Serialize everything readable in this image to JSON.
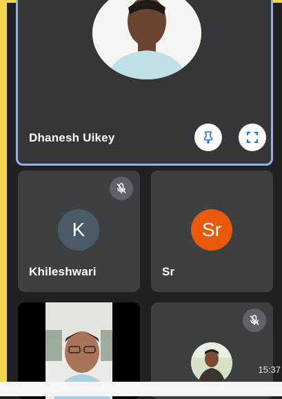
{
  "colors": {
    "background": "#202124",
    "tile": "#3c4043",
    "active_border": "#8ab4f8",
    "pin_icon": "#1a73e8",
    "avatar_k": "#4a5a66",
    "avatar_sr": "#e8590c"
  },
  "participants": [
    {
      "name": "Dhanesh Uikey",
      "type": "photo",
      "pinned": true
    },
    {
      "name": "Khileshwari",
      "initial": "K",
      "muted": true
    },
    {
      "name": "Sr",
      "initial": "Sr",
      "muted": false
    },
    {
      "name": "",
      "type": "video"
    },
    {
      "name": "",
      "type": "photo",
      "muted": true
    }
  ],
  "status": {
    "time": "15:37"
  },
  "icons": [
    "pin-icon",
    "fullscreen-icon",
    "mic-off-icon"
  ]
}
